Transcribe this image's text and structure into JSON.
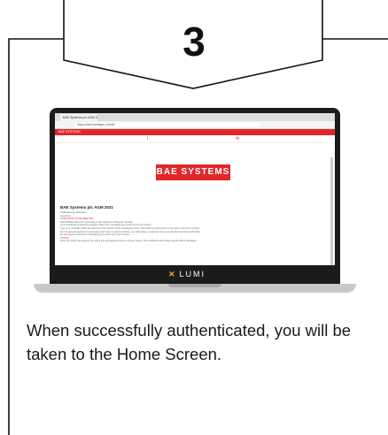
{
  "step": {
    "number": "3"
  },
  "browser": {
    "tab_title": "BAE Systems plc AGM 2021",
    "url": "https://web.lumiagm.com/#/"
  },
  "app": {
    "header_label": "BAE SYSTEMS",
    "logo_text": "BAE SYSTEMS",
    "meeting_title": "BAE Systems plc AGM 2021",
    "content_lines": [
      "AGM Meeting Information",
      "Questions:",
      "QUESTIONS AT THE MEETING",
      "Shareholders have the opportunity to ask questions during the meeting.",
      "If you would like to submit a question, select the messaging icon at the top of your screen.",
      "Type your message within the chat box at the bottom of the messaging screen, then click the send button to the right of the box to submit.",
      "For the general questions and answers and votes on each resolution, you will receive a response once your question has been submitted.",
      "Do remember to check the messaging icon at the top of your screen.",
      "VOTING",
      "Once the voting has opened, the voting icon will appear at the top of your screen. The resolutions and voting choices will be displayed."
    ],
    "brand": "LUMI"
  },
  "caption": "When successfully authenticated, you will be taken to the Home Screen."
}
